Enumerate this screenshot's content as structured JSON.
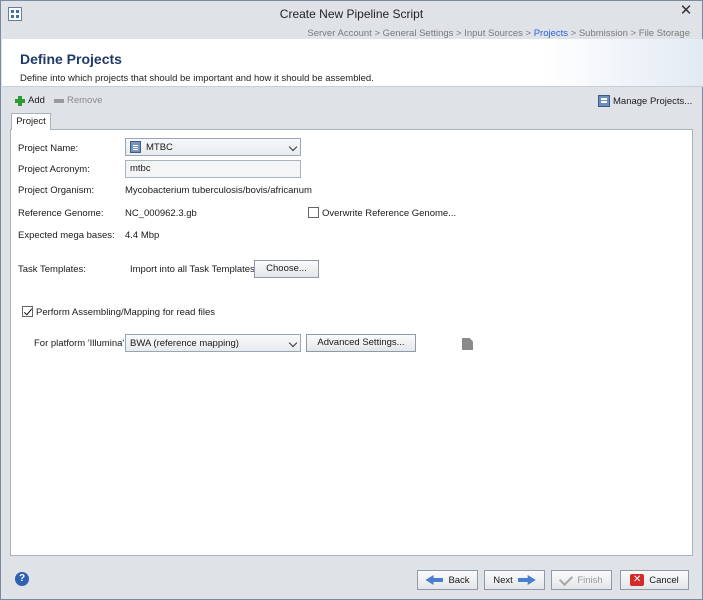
{
  "window": {
    "title": "Create New Pipeline Script"
  },
  "breadcrumb": {
    "before": "Server Account > General Settings > Input Sources > ",
    "active": "Projects",
    "after": " > Submission > File Storage"
  },
  "banner": {
    "title": "Define Projects",
    "description": "Define into which projects that should be important and how it should be assembled."
  },
  "toolbar": {
    "add": "Add",
    "remove": "Remove",
    "manage": "Manage Projects..."
  },
  "tab": {
    "label": "Project"
  },
  "form": {
    "project_name_label": "Project Name:",
    "project_name_value": "MTBC",
    "project_acronym_label": "Project Acronym:",
    "project_acronym_value": "mtbc",
    "project_organism_label": "Project Organism:",
    "project_organism_value": "Mycobacterium tuberculosis/bovis/africanum",
    "reference_genome_label": "Reference Genome:",
    "reference_genome_value": "NC_000962.3.gb",
    "overwrite_label": "Overwrite Reference Genome...",
    "overwrite_checked": false,
    "mega_bases_label": "Expected mega bases:",
    "mega_bases_value": "4.4 Mbp",
    "task_templates_label": "Task Templates:",
    "import_label": "Import into all Task Templates",
    "choose_button": "Choose...",
    "perform_label": "Perform Assembling/Mapping for read files",
    "perform_checked": true,
    "platform_label": "For platform 'Illumina':",
    "platform_value": "BWA (reference mapping)",
    "advanced_button": "Advanced Settings..."
  },
  "footer": {
    "help": "?",
    "back": "Back",
    "next": "Next",
    "finish": "Finish",
    "cancel": "Cancel"
  },
  "colors": {
    "accent": "#2b5fd9",
    "banner_title": "#1f3a66"
  }
}
